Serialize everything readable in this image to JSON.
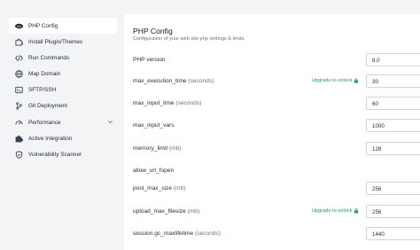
{
  "sidebar": {
    "items": [
      {
        "label": "PHP Config",
        "icon": "php-icon",
        "active": true
      },
      {
        "label": "Install Plugin/Themes",
        "icon": "puzzle-icon"
      },
      {
        "label": "Run Commands",
        "icon": "code-icon"
      },
      {
        "label": "Map Domain",
        "icon": "globe-icon"
      },
      {
        "label": "SFTP/SSH",
        "icon": "terminal-icon"
      },
      {
        "label": "Git Deployment",
        "icon": "git-icon"
      },
      {
        "label": "Performance",
        "icon": "gauge-icon",
        "expandable": true
      },
      {
        "label": "Active Integration",
        "icon": "puzzle-icon"
      },
      {
        "label": "Vulnerability Scanner",
        "icon": "shield-icon"
      }
    ]
  },
  "main": {
    "title": "PHP Config",
    "subtitle": "Configuration of your web site php settings & limits.",
    "settings": [
      {
        "label": "PHP version",
        "unit": "",
        "value": "8.0",
        "upgrade": ""
      },
      {
        "label": "max_execution_time",
        "unit": "(seconds)",
        "value": "30",
        "upgrade": "Upgrade to unlock"
      },
      {
        "label": "max_input_time",
        "unit": "(seconds)",
        "value": "60",
        "upgrade": ""
      },
      {
        "label": "max_input_vars",
        "unit": "",
        "value": "1000",
        "upgrade": ""
      },
      {
        "label": "memory_limit",
        "unit": "(mb)",
        "value": "128",
        "upgrade": ""
      },
      {
        "label": "allow_url_fopen",
        "unit": "",
        "value": "",
        "upgrade": ""
      },
      {
        "label": "post_max_size",
        "unit": "(mb)",
        "value": "256",
        "upgrade": ""
      },
      {
        "label": "upload_max_filesize",
        "unit": "(mb)",
        "value": "256",
        "upgrade": "Upgrade to unlock"
      },
      {
        "label": "session.gc_maxlifetime",
        "unit": "(seconds)",
        "value": "1440",
        "upgrade": ""
      }
    ]
  },
  "colors": {
    "accent_green": "#16a34a",
    "background": "#f3f4f6",
    "panel": "#ffffff"
  }
}
